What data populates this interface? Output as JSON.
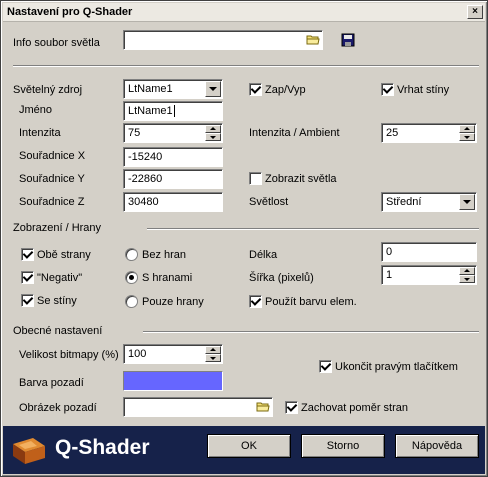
{
  "window": {
    "title": "Nastavení pro Q-Shader",
    "close_glyph": "×"
  },
  "info": {
    "label": "Info soubor světla",
    "value": ""
  },
  "light": {
    "source_label": "Světelný zdroj",
    "source_value": "LtName1",
    "name_label": "Jméno",
    "name_value": "LtName1",
    "intensity_label": "Intenzita",
    "intensity_value": "75",
    "x_label": "Souřadnice X",
    "x_value": "-15240",
    "y_label": "Souřadnice Y",
    "y_value": "-22860",
    "z_label": "Souřadnice Z",
    "z_value": "30480",
    "onoff_label": "Zap/Vyp",
    "onoff_checked": true,
    "shadows_label": "Vrhat stíny",
    "shadows_checked": true,
    "ambient_label": "Intenzita / Ambient",
    "ambient_value": "25",
    "show_lights_label": "Zobrazit světla",
    "show_lights_checked": false,
    "brightness_label": "Světlost",
    "brightness_value": "Střední"
  },
  "display": {
    "section_label": "Zobrazení / Hrany",
    "both_sides_label": "Obě strany",
    "both_sides_checked": true,
    "negative_label": "\"Negativ\"",
    "negative_checked": true,
    "with_shadows_label": "Se stíny",
    "with_shadows_checked": true,
    "no_edges_label": "Bez hran",
    "with_edges_label": "S hranami",
    "edges_only_label": "Pouze hrany",
    "selected_edge_mode": "with_edges",
    "length_label": "Délka",
    "length_value": "0",
    "width_label": "Šířka (pixelů)",
    "width_value": "1",
    "use_color_label": "Použít barvu elem.",
    "use_color_checked": true
  },
  "general": {
    "section_label": "Obecné nastavení",
    "bitmap_size_label": "Velikost bitmapy (%)",
    "bitmap_size_value": "100",
    "bg_color_label": "Barva pozadí",
    "bg_color": "#6666ff",
    "bg_image_label": "Obrázek pozadí",
    "bg_image_value": "",
    "right_click_label": "Ukončit pravým tlačítkem",
    "right_click_checked": true,
    "keep_ratio_label": "Zachovat poměr stran",
    "keep_ratio_checked": true
  },
  "footer": {
    "logo_text": "Q-Shader",
    "ok_label": "OK",
    "cancel_label": "Storno",
    "help_label": "Nápověda"
  },
  "icons": [
    "close-icon",
    "folder-icon",
    "save-disk-icon",
    "dropdown-arrow-icon",
    "spin-up-icon",
    "spin-down-icon",
    "q-shader-logo-icon"
  ],
  "colors": {
    "footer_bg": "#16224a",
    "dialog_bg": "#d4d0c8",
    "bg_color_swatch": "#6666ff"
  }
}
